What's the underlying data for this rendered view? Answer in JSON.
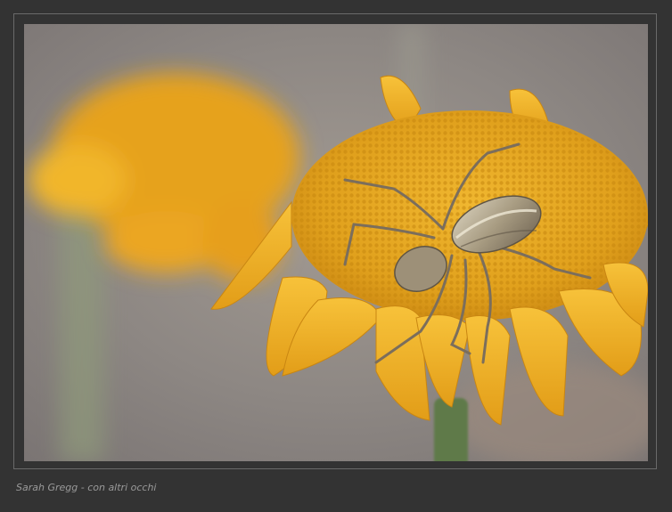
{
  "photo": {
    "subject": "spider-on-yellow-flower",
    "colors": {
      "frame_background": "#333333",
      "flower_center": "#e3a21b",
      "petal": "#f4b62a",
      "background_blur": "#8d8783"
    }
  },
  "caption": {
    "text": "Sarah Gregg - con altri occhi"
  }
}
